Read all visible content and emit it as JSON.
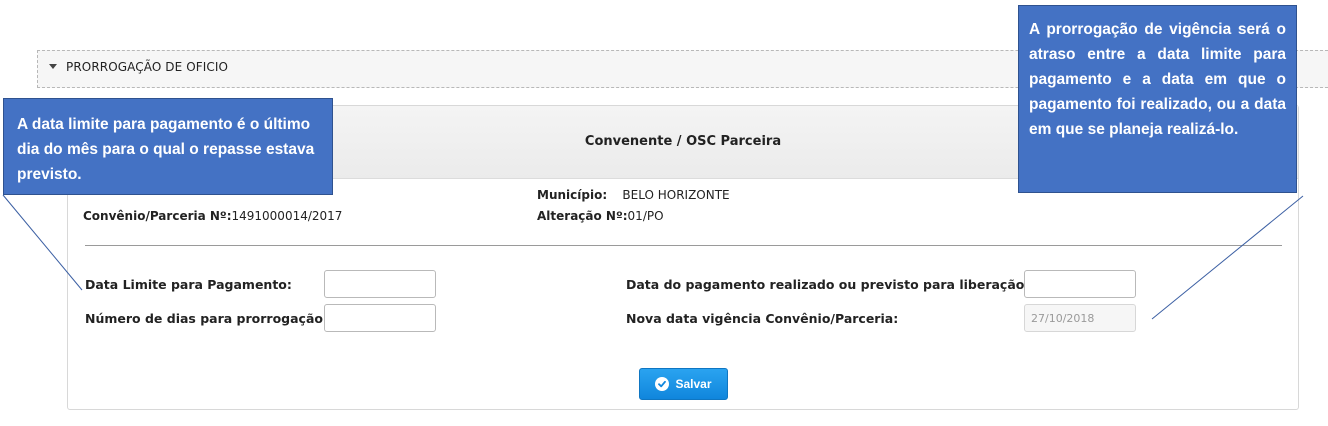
{
  "accordion": {
    "title": "PRORROGAÇÃO DE OFICIO"
  },
  "panel": {
    "title": "Convenente / OSC Parceira",
    "info": {
      "convenio_label": "Convênio/Parceria Nº:",
      "convenio_value": "1491000014/2017",
      "municipio_label": "Município:",
      "municipio_value": "BELO HORIZONTE",
      "alteracao_label": "Alteração Nº:",
      "alteracao_value": "01/PO"
    },
    "form": {
      "data_limite_label": "Data Limite para Pagamento:",
      "data_limite_value": "",
      "dias_label": "Número de dias para prorrogação:",
      "dias_value": "",
      "data_pagamento_label": "Data do pagamento realizado ou previsto para liberação:",
      "data_pagamento_value": "",
      "nova_data_label": "Nova data vigência Convênio/Parceria:",
      "nova_data_value": "27/10/2018"
    },
    "save_label": "Salvar"
  },
  "callouts": {
    "left": "A data limite para pagamento é o último dia do mês para o qual o repasse estava previsto.",
    "right": "A prorrogação de vigência será o atraso entre a data limite para pagamento e a data em que o pagamento foi realizado, ou a data em que se planeja realizá-lo."
  },
  "colors": {
    "callout_fill": "#4472c4",
    "save_button": "#1a8fe3"
  }
}
